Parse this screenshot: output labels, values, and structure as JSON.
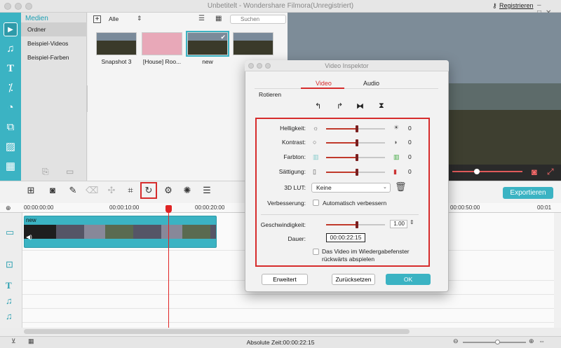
{
  "window": {
    "title": "Unbetitelt - Wondershare Filmora(Unregistriert)",
    "register_link": "Registrieren",
    "controls": [
      "close-icon",
      "minimize-icon",
      "maximize-icon"
    ]
  },
  "rail": {
    "items": [
      {
        "name": "media-icon",
        "glyph": "▶",
        "active": true
      },
      {
        "name": "music-icon",
        "glyph": "♫"
      },
      {
        "name": "text-icon",
        "glyph": "T"
      },
      {
        "name": "transition-icon",
        "glyph": "⁒"
      },
      {
        "name": "filter-icon",
        "glyph": "◔"
      },
      {
        "name": "overlay-icon",
        "glyph": "⧉"
      },
      {
        "name": "image-icon",
        "glyph": "▨"
      },
      {
        "name": "split-screen-icon",
        "glyph": "▦"
      }
    ]
  },
  "media": {
    "header": "Medien",
    "items": [
      {
        "label": "Ordner",
        "selected": true
      },
      {
        "label": "Beispiel-Videos"
      },
      {
        "label": "Beispiel-Farben"
      }
    ],
    "filter": "Alle",
    "search_placeholder": "Suchen",
    "thumbnails": [
      {
        "label": "Snapshot 3",
        "style": "vid"
      },
      {
        "label": "[House] Roo...",
        "style": "pink"
      },
      {
        "label": "new",
        "style": "vid",
        "selected": true
      },
      {
        "label": "",
        "style": "vid"
      }
    ]
  },
  "toolbar": {
    "tools": [
      {
        "name": "add-media-icon",
        "glyph": "⊞"
      },
      {
        "name": "snapshot-icon",
        "glyph": "◙"
      },
      {
        "name": "pen-icon",
        "glyph": "✎"
      },
      {
        "name": "delete-icon",
        "glyph": "🗑",
        "disabled": true
      },
      {
        "name": "speed-icon",
        "glyph": "✣",
        "disabled": true
      },
      {
        "name": "crop-icon",
        "glyph": "⌗"
      },
      {
        "name": "rotate-icon",
        "glyph": "↻",
        "highlight": true
      },
      {
        "name": "settings-icon",
        "glyph": "⚙"
      },
      {
        "name": "color-icon",
        "glyph": "✺"
      },
      {
        "name": "adjust-icon",
        "glyph": "☰"
      }
    ],
    "export_label": "Exportieren"
  },
  "ruler": {
    "timecodes": [
      "00:00:00:00",
      "00:00:10:00",
      "00:00:20:00",
      "00:00:50:00",
      "00:01"
    ]
  },
  "timeline": {
    "clip_name": "new"
  },
  "status": {
    "absolute_time": "Absolute Zeit:00:00:22:15"
  },
  "dialog": {
    "title": "Video Inspektor",
    "tabs": [
      {
        "label": "Video",
        "active": true
      },
      {
        "label": "Audio"
      }
    ],
    "rotate_label": "Rotieren",
    "adjustments": [
      {
        "label": "Helligkeit:",
        "value": "0",
        "level": 0.52
      },
      {
        "label": "Kontrast:",
        "value": "0",
        "level": 0.52
      },
      {
        "label": "Farbton:",
        "value": "0",
        "level": 0.52
      },
      {
        "label": "Sättigung:",
        "value": "0",
        "level": 0.52
      }
    ],
    "lut_label": "3D LUT:",
    "lut_value": "Keine",
    "enhance_label": "Verbesserung:",
    "enhance_option": "Automatisch verbessern",
    "speed_label": "Geschwindigkeit:",
    "speed_value": "1.00",
    "speed_level": 0.52,
    "duration_label": "Dauer:",
    "duration_value": "00:00:22:15",
    "reverse_label_1": "Das Video im Wiedergabefenster",
    "reverse_label_2": "rückwärts abspielen",
    "buttons": {
      "advanced": "Erweitert",
      "reset": "Zurücksetzen",
      "ok": "OK"
    }
  },
  "colors": {
    "accent": "#3bb3c3",
    "highlight": "#d62c2c"
  }
}
